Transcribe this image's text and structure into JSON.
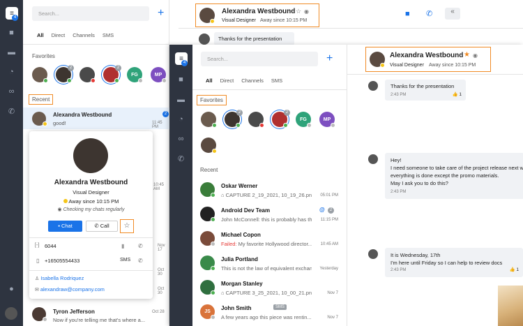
{
  "back": {
    "rail_badge": "4",
    "search_placeholder": "Search...",
    "tabs": [
      "All",
      "Direct",
      "Channels",
      "SMS"
    ],
    "favorites_title": "Favorites",
    "favorites": [
      {
        "label": "",
        "badge": ""
      },
      {
        "label": "",
        "badge": "2"
      },
      {
        "label": "",
        "badge": ""
      },
      {
        "label": "",
        "badge": "2"
      },
      {
        "label": "FG",
        "badge": ""
      },
      {
        "label": "MP",
        "badge": ""
      }
    ],
    "recent_title": "Recent",
    "recent": [
      {
        "name": "Alexandra Westbound",
        "preview": "good!",
        "time": "11:45 PM",
        "badge": "2"
      },
      {
        "name": "Tyron Jefferson",
        "preview": "Now if you're telling me that's where a...",
        "time": "Oct 28"
      }
    ],
    "partial_times": [
      "10:45 AM",
      "Nov 17",
      "Nov 17",
      "Oct 30",
      "Oct 30"
    ],
    "header": {
      "name": "Alexandra Westbound",
      "title": "Visual Designer",
      "status": "Away since 10:15 PM"
    },
    "message": "Thanks for the presentation"
  },
  "card": {
    "name": "Alexandra Westbound",
    "title": "Visual Designer",
    "status": "Away since 10:15 PM",
    "note": "Checking my chats regularly",
    "chat_label": "Chat",
    "call_label": "Call",
    "phones": [
      {
        "value": "6044",
        "tag": ""
      },
      {
        "value": "+16505554433",
        "tag": "SMS"
      }
    ],
    "manager": "Isabella Rodriquez",
    "email": "alexandraw@company.com"
  },
  "front": {
    "rail_badge": "4",
    "search_placeholder": "Search...",
    "tabs": [
      "All",
      "Direct",
      "Channels",
      "SMS"
    ],
    "favorites_title": "Favorites",
    "favorites": [
      {
        "label": "",
        "badge": ""
      },
      {
        "label": "",
        "badge": "2"
      },
      {
        "label": "",
        "badge": ""
      },
      {
        "label": "",
        "badge": "2"
      },
      {
        "label": "FG",
        "badge": ""
      },
      {
        "label": "MP",
        "badge": ""
      },
      {
        "label": "",
        "badge": ""
      }
    ],
    "recent_title": "Recent",
    "recent": [
      {
        "name": "Oskar Werner",
        "preview": "CAPTURE 2_19_2021, 10_19_26.png",
        "time": "05:01 PM",
        "badge": "",
        "failed": ""
      },
      {
        "name": "Android Dev Team",
        "preview": "John McConnell: this is probably has the ...",
        "time": "11:15 PM",
        "badge": "2",
        "failed": ""
      },
      {
        "name": "Michael Copon",
        "preview": "My favorite Hollywood director...",
        "time": "10:45 AM",
        "badge": "",
        "failed": "Failed:"
      },
      {
        "name": "Julia Portland",
        "preview": "This is not the law of equivalent exchan...",
        "time": "Yesterday",
        "badge": "",
        "failed": ""
      },
      {
        "name": "Morgan Stanley",
        "preview": "CAPTURE 3_25_2021, 10_00_21.png",
        "time": "Nov 7",
        "badge": "",
        "failed": ""
      },
      {
        "name": "John Smith",
        "preview": "A few years ago this piece was rentin...",
        "time": "Nov 7",
        "badge": "",
        "failed": "",
        "tag": "SMS",
        "initials": "JS"
      }
    ],
    "header": {
      "name": "Alexandra Westbound",
      "title": "Visual Designer",
      "status": "Away since 10:15 PM"
    },
    "messages": [
      {
        "lines": [
          "Thanks for the presentation"
        ],
        "time": "2:43 PM",
        "reaction": "1"
      },
      {
        "lines": [
          "Hey!",
          "I need someone to take care of the project release next w",
          "everything is done except the promo materials.",
          "May I ask you to do this?"
        ],
        "time": "2:43 PM",
        "reaction": ""
      },
      {
        "lines": [
          "It is Wednesday, 17th",
          "I'm here until Friday so I can help to review docs"
        ],
        "time": "2:43 PM",
        "reaction": "1"
      }
    ]
  },
  "colors": {
    "rail": "#2e3440",
    "accent": "#1a73e8",
    "highlight": "#f08a24",
    "online": "#4caf50",
    "away": "#f5c518",
    "busy": "#e53935",
    "failed": "#e53935"
  }
}
